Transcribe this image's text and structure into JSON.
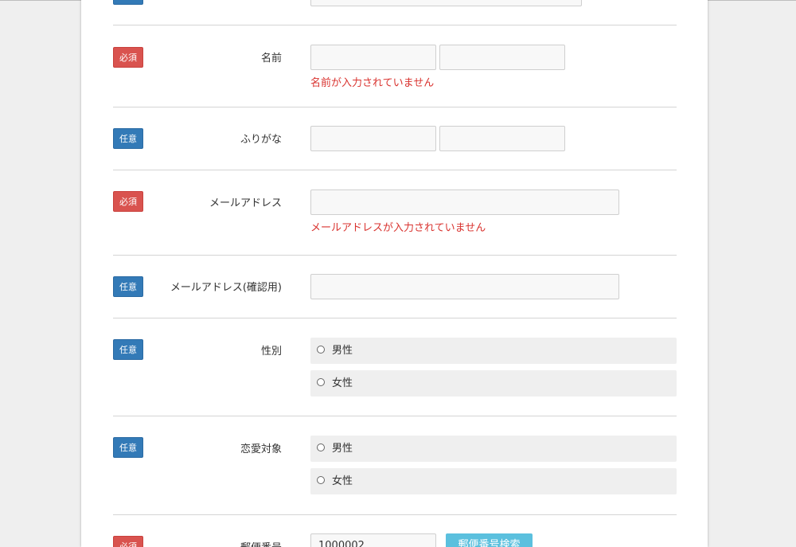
{
  "badges": {
    "required": "必須",
    "optional": "任意"
  },
  "fields": {
    "name": {
      "label": "名前",
      "error": "名前が入力されていません"
    },
    "furigana": {
      "label": "ふりがな"
    },
    "email": {
      "label": "メールアドレス",
      "error": "メールアドレスが入力されていません"
    },
    "email_confirm": {
      "label": "メールアドレス(確認用)"
    },
    "gender": {
      "label": "性別",
      "options": [
        "男性",
        "女性"
      ]
    },
    "love_target": {
      "label": "恋愛対象",
      "options": [
        "男性",
        "女性"
      ]
    },
    "postal_code": {
      "label": "郵便番号",
      "value": "1000002",
      "search_button": "郵便番号検索"
    }
  },
  "colors": {
    "required": "#d9534f",
    "optional": "#337ab7",
    "error": "#d9332f",
    "search_button": "#5bc0de"
  }
}
